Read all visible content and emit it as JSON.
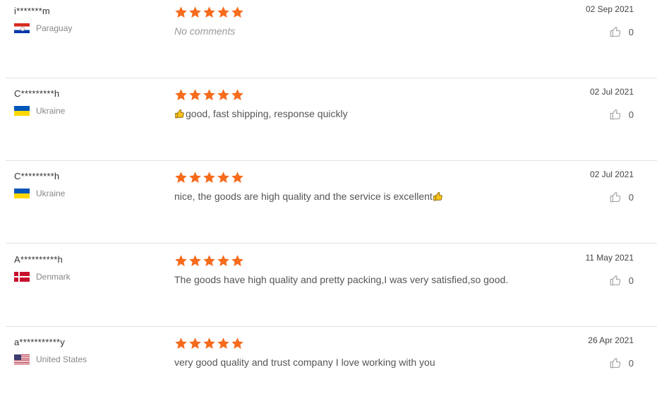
{
  "colors": {
    "star": "#f76b1c",
    "divider": "#e2e2e2"
  },
  "reviews": [
    {
      "user": "i*******m",
      "country": "Paraguay",
      "flag": "paraguay-flag-icon",
      "rating": 5,
      "comment": "No comments",
      "comment_empty": true,
      "date": "02 Sep 2021",
      "likes": "0"
    },
    {
      "user": "C*********h",
      "country": "Ukraine",
      "flag": "ukraine-flag-icon",
      "rating": 5,
      "comment": "good, fast shipping, response quickly",
      "emoji": "thumbs-up-emoji-before",
      "date": "02 Jul 2021",
      "likes": "0"
    },
    {
      "user": "C*********h",
      "country": "Ukraine",
      "flag": "ukraine-flag-icon",
      "rating": 5,
      "comment": "nice, the goods are high quality and the service is excellent",
      "emoji": "thumbs-up-emoji-after",
      "date": "02 Jul 2021",
      "likes": "0"
    },
    {
      "user": "A**********h",
      "country": "Denmark",
      "flag": "denmark-flag-icon",
      "rating": 5,
      "comment": "The goods have high quality and pretty packing,I was very satisfied,so good.",
      "date": "11 May 2021",
      "likes": "0"
    },
    {
      "user": "a***********y",
      "country": "United States",
      "flag": "us-flag-icon",
      "rating": 5,
      "comment": "very good quality and trust company I love working with you",
      "date": "26 Apr 2021",
      "likes": "0"
    }
  ]
}
